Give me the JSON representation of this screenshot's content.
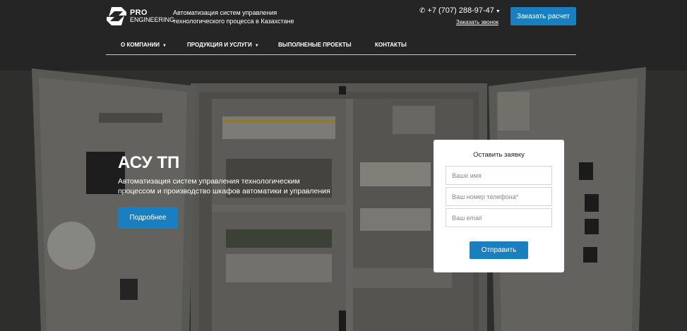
{
  "brand": {
    "logo_line1": "PRO",
    "logo_line2": "ENGINEERING",
    "tagline": "Автоматизация систем управления технологического процесса в Казахстане"
  },
  "contact": {
    "phone": "+7 (707) 288-97-47",
    "callback_label": "Заказать звонок"
  },
  "header": {
    "order_button": "Заказать расчет"
  },
  "nav": {
    "items": [
      {
        "label": "О КОМПАНИИ",
        "has_dropdown": true
      },
      {
        "label": "ПРОДУКЦИЯ И УСЛУГИ",
        "has_dropdown": true
      },
      {
        "label": "ВЫПОЛНЕНЫЕ ПРОЕКТЫ",
        "has_dropdown": false
      },
      {
        "label": "КОНТАКТЫ",
        "has_dropdown": false
      }
    ]
  },
  "hero": {
    "title": "АСУ ТП",
    "description": "Автоматизация систем управления технологическим процессом и производство шкафов автоматики и управления",
    "more_button": "Подробнее"
  },
  "form": {
    "title": "Оставить заявку",
    "name_placeholder": "Ваше имя",
    "phone_placeholder": "Ваш номер телефона*",
    "email_placeholder": "Ваш email",
    "submit_label": "Отправить"
  },
  "colors": {
    "accent": "#1a7fc1",
    "card_bg": "#ffffff"
  },
  "icons": {
    "phone": "phone-icon",
    "dropdown": "chevron-down-icon"
  }
}
